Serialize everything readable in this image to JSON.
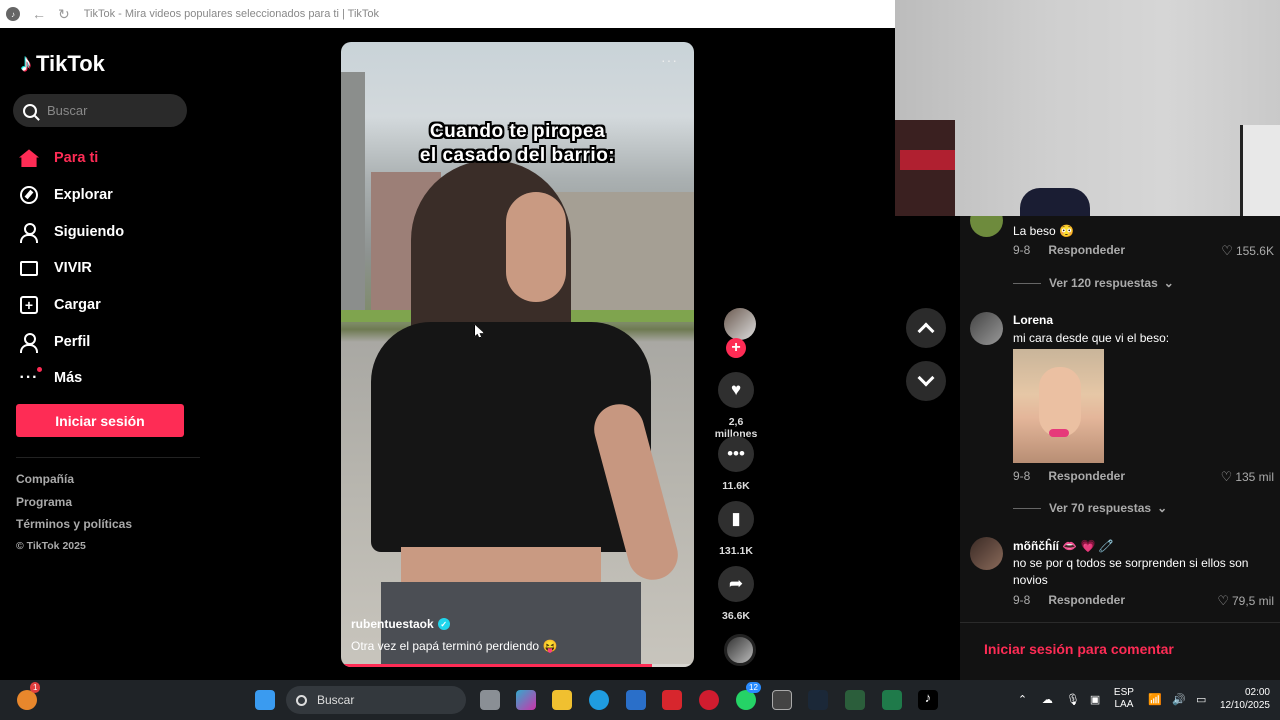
{
  "browser": {
    "title": "TikTok - Mira videos populares seleccionados para ti | TikTok"
  },
  "sidebar": {
    "logo": "TikTok",
    "search_placeholder": "Buscar",
    "items": [
      {
        "label": "Para ti",
        "icon": "home-icon",
        "active": true
      },
      {
        "label": "Explorar",
        "icon": "compass-icon"
      },
      {
        "label": "Siguiendo",
        "icon": "following-icon"
      },
      {
        "label": "VIVIR",
        "icon": "live-tv-icon"
      },
      {
        "label": "Cargar",
        "icon": "upload-icon"
      },
      {
        "label": "Perfil",
        "icon": "profile-icon"
      },
      {
        "label": "Más",
        "icon": "more-icon"
      }
    ],
    "login_label": "Iniciar sesión",
    "footer": [
      "Compañía",
      "Programa",
      "Términos y políticas"
    ],
    "copyright": "© TikTok 2025"
  },
  "video": {
    "caption_line1": "Cuando te piropea",
    "caption_line2": "el casado del barrio:",
    "author": "rubentuestaok",
    "description": "Otra vez el papá terminó perdiendo 😝",
    "progress": 0.88
  },
  "actions": {
    "likes": "2,6 millones",
    "comments": "11.6K",
    "saves": "131.1K",
    "shares": "36.6K"
  },
  "comments": {
    "items": [
      {
        "name": "",
        "text": "La beso 😳",
        "date": "9-8",
        "reply": "Respondeder",
        "likes": "155.6K",
        "more": "Ver 120 respuestas"
      },
      {
        "name": "Lorena",
        "text": "mi cara desde que vi el beso:",
        "date": "9-8",
        "reply": "Respondeder",
        "likes": "135 mil",
        "more": "Ver 70 respuestas"
      },
      {
        "name": "mõñčĥíí 👄 💗 🧷",
        "text": "no se por q todos se sorprenden si ellos son novios",
        "date": "9-8",
        "reply": "Respondeder",
        "likes": "79,5 mil"
      }
    ],
    "login_prompt": "Iniciar sesión para comentar"
  },
  "taskbar": {
    "search_label": "Buscar",
    "lang_top": "ESP",
    "lang_bottom": "LAA",
    "time": "02:00",
    "date": "12/10/2025",
    "badge_1": "1",
    "badge_2": "12"
  },
  "colors": {
    "accent": "#fe2c55",
    "sidebar_bg": "#000000",
    "comments_bg": "#121212",
    "taskbar_bg": "#1f2327"
  }
}
